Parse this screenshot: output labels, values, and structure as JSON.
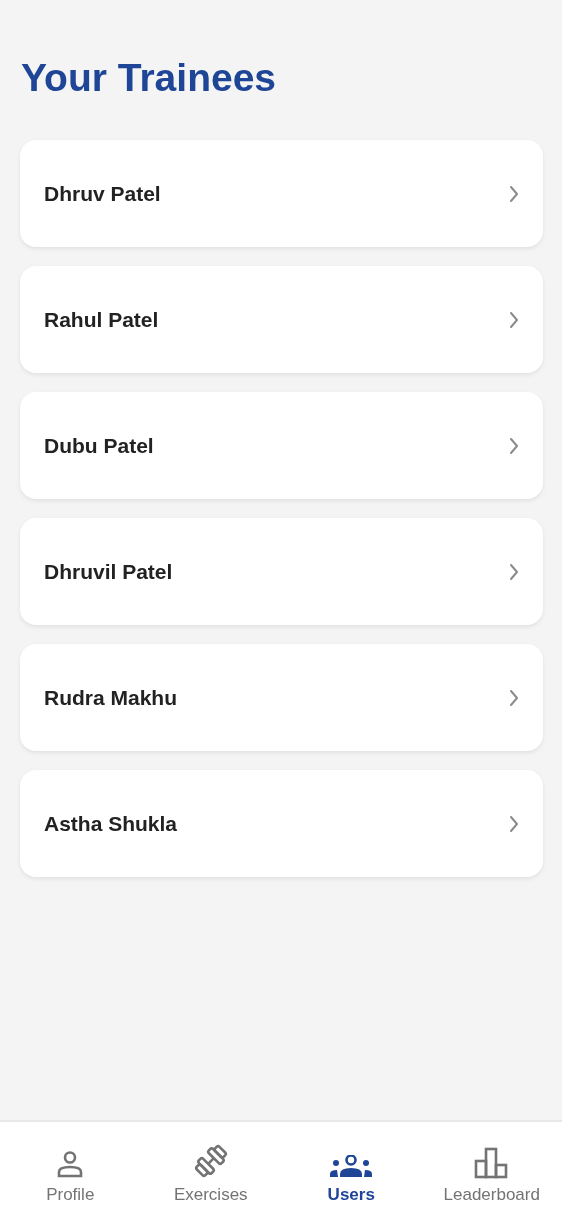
{
  "title": "Your Trainees",
  "trainees": [
    {
      "name": "Dhruv Patel"
    },
    {
      "name": "Rahul Patel"
    },
    {
      "name": "Dubu Patel"
    },
    {
      "name": "Dhruvil Patel"
    },
    {
      "name": "Rudra Makhu"
    },
    {
      "name": "Astha Shukla"
    }
  ],
  "nav": [
    {
      "label": "Profile",
      "kind": "person",
      "selected": false
    },
    {
      "label": "Exercises",
      "kind": "dumbbell",
      "selected": false
    },
    {
      "label": "Users",
      "kind": "group",
      "selected": true
    },
    {
      "label": "Leaderboard",
      "kind": "chart",
      "selected": false
    }
  ]
}
